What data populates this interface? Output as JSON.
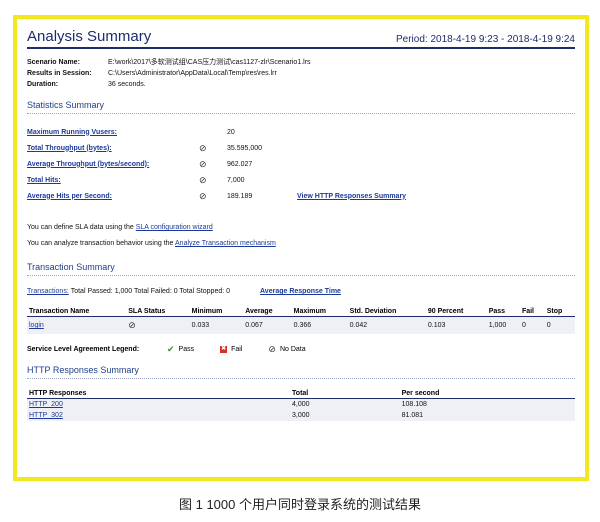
{
  "report": {
    "title": "Analysis Summary",
    "period": "Period: 2018-4-19 9:23 - 2018-4-19 9:24"
  },
  "meta": [
    {
      "key": "Scenario Name:",
      "value": "E:\\work\\2017\\多软测试组\\CAS压力测试\\cas1127-zlr\\Scenario1.lrs"
    },
    {
      "key": "Results in Session:",
      "value": "C:\\Users\\Administrator\\AppData\\Local\\Temp\\res\\res.lrr"
    },
    {
      "key": "Duration:",
      "value": "36 seconds."
    }
  ],
  "stats_summary": {
    "title": "Statistics Summary",
    "rows": [
      {
        "label": "Maximum Running Vusers:",
        "icon": "",
        "value": "20",
        "extra": ""
      },
      {
        "label": "Total Throughput (bytes):",
        "icon": "no-data-icon",
        "value": "35.595,000",
        "extra": ""
      },
      {
        "label": "Average Throughput (bytes/second):",
        "icon": "no-data-icon",
        "value": "962.027",
        "extra": ""
      },
      {
        "label": "Total Hits:",
        "icon": "no-data-icon",
        "value": "7,000",
        "extra": ""
      },
      {
        "label": "Average Hits per Second:",
        "icon": "no-data-icon",
        "value": "189.189",
        "extra": "View HTTP Responses Summary"
      }
    ]
  },
  "sla": {
    "line1_pre": "You can define SLA data using the",
    "line1_link": "SLA configuration wizard",
    "line2_pre": "You can analyze transaction behavior using the",
    "line2_link": "Analyze Transaction mechanism"
  },
  "transaction_summary": {
    "title": "Transaction Summary",
    "label": "Transactions:",
    "text": "Total Passed: 1,000 Total Failed: 0 Total Stopped: 0",
    "avg_link": "Average Response Time",
    "headers": [
      "Transaction Name",
      "SLA Status",
      "Minimum",
      "Average",
      "Maximum",
      "Std. Deviation",
      "90 Percent",
      "Pass",
      "Fail",
      "Stop"
    ],
    "rows": [
      {
        "name": "login",
        "minimum": "0.033",
        "average": "0.067",
        "maximum": "0.366",
        "std": "0.042",
        "p90": "0.103",
        "pass": "1,000",
        "fail": "0",
        "stop": "0"
      }
    ]
  },
  "legend": {
    "title": "Service Level Agreement Legend:",
    "pass": "Pass",
    "fail": "Fail",
    "nodata": "No Data"
  },
  "http_summary": {
    "title": "HTTP Responses Summary",
    "headers": [
      "HTTP Responses",
      "Total",
      "Per second"
    ],
    "rows": [
      {
        "code": "HTTP_200",
        "total": "4,000",
        "per_second": "108.108"
      },
      {
        "code": "HTTP_302",
        "total": "3,000",
        "per_second": "81.081"
      }
    ]
  },
  "caption": "图 1 1000 个用户同时登录系统的测试结果",
  "colors": {
    "frame": "#f2e81d",
    "title": "#1e2c6e",
    "link": "#1a3a9a"
  }
}
